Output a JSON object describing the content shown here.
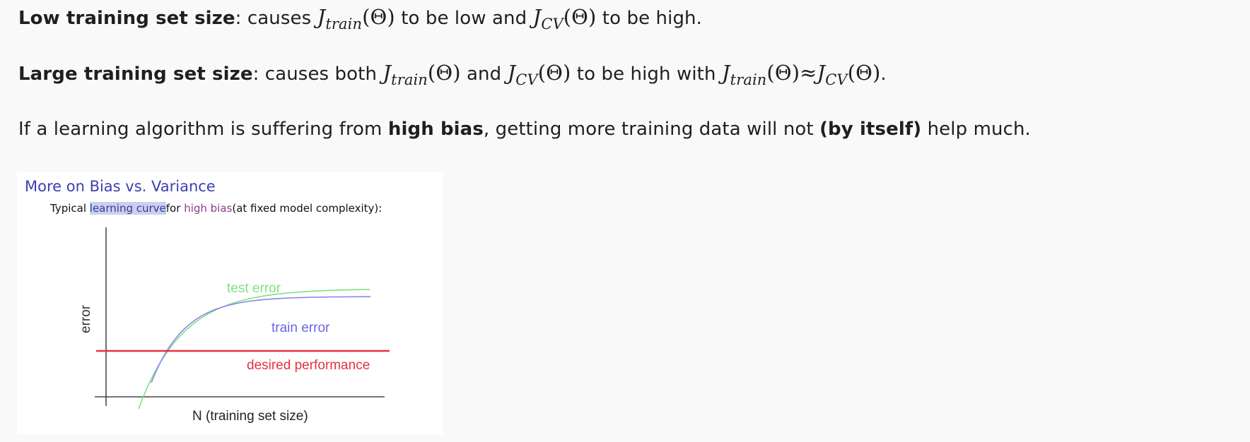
{
  "paragraphs": {
    "p1": {
      "bold": "Low training set size",
      "t1": ": causes ",
      "j1": "J",
      "s1": "train",
      "a1": "(Θ)",
      "t2": " to be low and ",
      "j2": "J",
      "s2": "CV",
      "a2": "(Θ)",
      "t3": " to be high."
    },
    "p2": {
      "bold": "Large training set size",
      "t1": ": causes both ",
      "j1": "J",
      "s1": "train",
      "a1": "(Θ)",
      "t2": " and ",
      "j2": "J",
      "s2": "CV",
      "a2": "(Θ)",
      "t3": " to be high with ",
      "j3": "J",
      "s3": "train",
      "a3": "(Θ)≈",
      "j4": "J",
      "s4": "CV",
      "a4": "(Θ)",
      "t4": "."
    },
    "p3": {
      "t1": "If a learning algorithm is suffering from ",
      "b1": "high bias",
      "t2": ", getting more training data will not ",
      "b2": "(by itself)",
      "t3": " help much."
    }
  },
  "figure": {
    "title": "More on Bias vs. Variance",
    "subtitle_prefix": "Typical ",
    "subtitle_highlight": "learning curve",
    "subtitle_for": "for ",
    "subtitle_bias": "high bias",
    "subtitle_suffix": "(at fixed model complexity):",
    "colors": {
      "title": "#3d3db3",
      "test_error": "#7fe07f",
      "train_error": "#8a86f0",
      "desired": "#e83040",
      "axis": "#222222"
    }
  },
  "chart_data": {
    "type": "line",
    "xlabel": "N (training set size)",
    "ylabel": "error",
    "grid": false,
    "series": [
      {
        "name": "test error",
        "shape": "decreasing, flattening to an asymptote above train error"
      },
      {
        "name": "train error",
        "shape": "increasing, flattening to an asymptote just below test error"
      },
      {
        "name": "desired performance",
        "shape": "horizontal line below both asymptotes"
      }
    ]
  }
}
